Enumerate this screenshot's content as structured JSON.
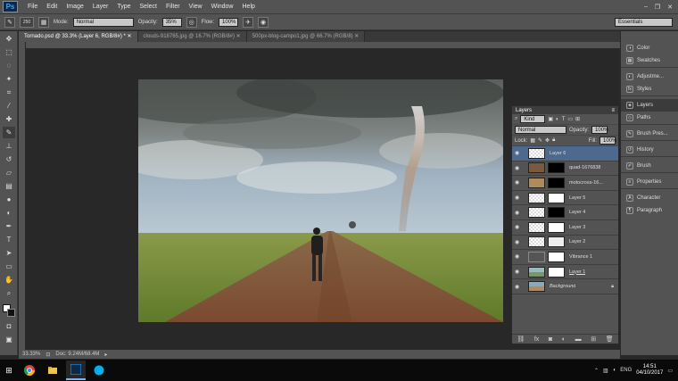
{
  "app": {
    "logo": "Ps"
  },
  "menu": [
    "File",
    "Edit",
    "Image",
    "Layer",
    "Type",
    "Select",
    "Filter",
    "View",
    "Window",
    "Help"
  ],
  "options": {
    "brush_size": "250",
    "mode_label": "Mode:",
    "mode_value": "Normal",
    "opacity_label": "Opacity:",
    "opacity_value": "35%",
    "flow_label": "Flow:",
    "flow_value": "100%",
    "workspace": "Essentials"
  },
  "tabs": [
    {
      "label": "Tornado.psd @ 33.3% (Layer 6, RGB/8#) *"
    },
    {
      "label": "clouds-918765.jpg @ 16.7% (RGB/8#)"
    },
    {
      "label": "500px-blog-campo1.jpg @ 66.7% (RGB/8)"
    }
  ],
  "status": {
    "zoom": "33.33%",
    "doc": "Doc: 9.24M/68.4M"
  },
  "dock": {
    "group1": [
      "Color",
      "Swatches"
    ],
    "group2": [
      "Adjustme...",
      "Styles"
    ],
    "group3": [
      "Layers",
      "Paths"
    ],
    "group4": [
      "Brush Pres..."
    ],
    "group5": [
      "History"
    ],
    "group6": [
      "Brush"
    ],
    "group7": [
      "Properties"
    ],
    "group8": [
      "Character",
      "Paragraph"
    ]
  },
  "layers_panel": {
    "title": "Layers",
    "filter": "Kind",
    "blend": "Normal",
    "opacity_label": "Opacity:",
    "opacity": "100%",
    "lock_label": "Lock:",
    "fill_label": "Fill:",
    "fill": "100%",
    "layers": [
      {
        "name": "Layer 6"
      },
      {
        "name": "quad-1676838"
      },
      {
        "name": "motocross-16..."
      },
      {
        "name": "Layer 5"
      },
      {
        "name": "Layer 4"
      },
      {
        "name": "Layer 3"
      },
      {
        "name": "Layer 2"
      },
      {
        "name": "Vibrance 1"
      },
      {
        "name": "Layer 1"
      },
      {
        "name": "Background"
      }
    ],
    "footer_fx": "fx"
  },
  "taskbar": {
    "lang": "ENG",
    "time": "14:51",
    "date": "04/10/2017"
  }
}
